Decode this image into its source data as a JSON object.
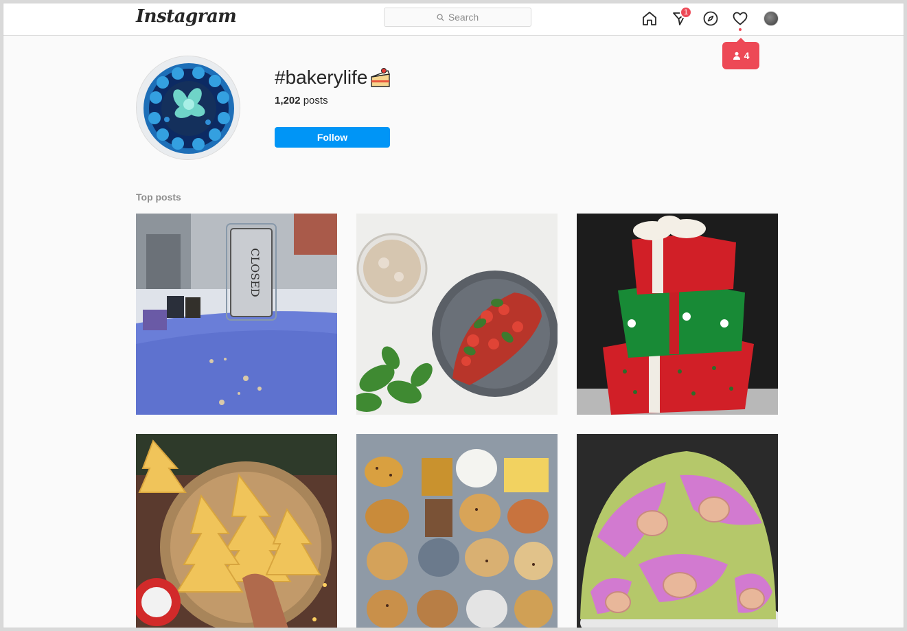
{
  "header": {
    "logo": "Instagram",
    "search_placeholder": "Search",
    "dm_badge": "1"
  },
  "notification_popup": {
    "count": "4"
  },
  "hashtag": {
    "title": "#bakerylife",
    "post_count_number": "1,202",
    "post_count_label": "posts",
    "follow_label": "Follow"
  },
  "top_posts": {
    "label": "Top posts",
    "closed_sign_text": "CLOSED",
    "posts": [
      {
        "subject": "closed-sign-window"
      },
      {
        "subject": "tomato-toast-latte"
      },
      {
        "subject": "christmas-gift-cake"
      },
      {
        "subject": "tree-shaped-cookies"
      },
      {
        "subject": "pastry-tray"
      },
      {
        "subject": "swiss-roll-dome-cake"
      }
    ]
  },
  "colors": {
    "accent_blue": "#0095f6",
    "notification_red": "#ed4956",
    "border": "#dbdbdb",
    "muted_text": "#8e8e8e"
  }
}
